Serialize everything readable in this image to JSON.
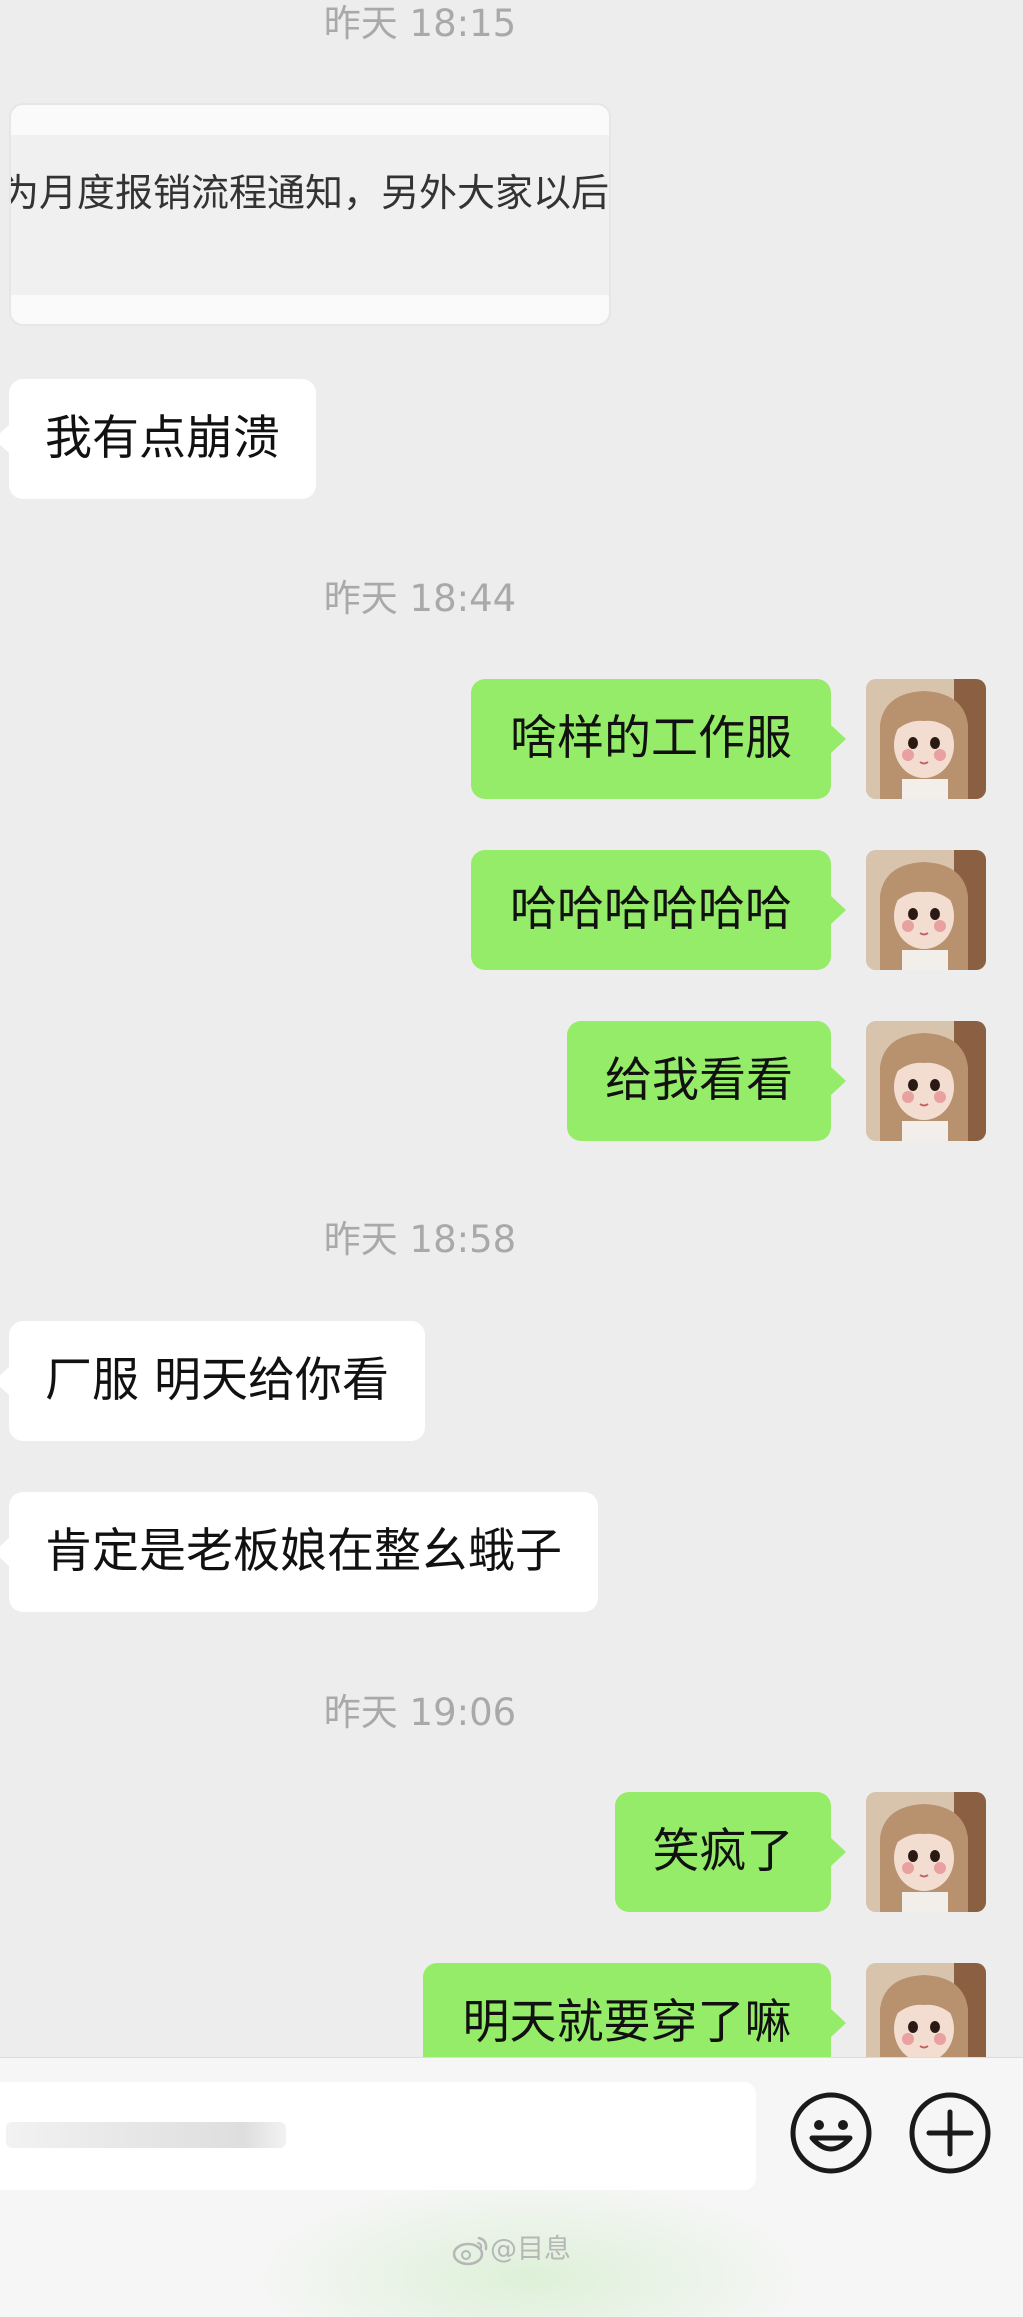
{
  "timestamps": [
    "昨天 18:15",
    "昨天 18:44",
    "昨天 18:58",
    "昨天 19:06"
  ],
  "document_preview": {
    "text": "为月度报销流程通知，另外大家以后"
  },
  "messages": [
    {
      "side": "in",
      "text": "我有点崩溃"
    },
    {
      "side": "out",
      "text": "啥样的工作服"
    },
    {
      "side": "out",
      "text": "哈哈哈哈哈哈"
    },
    {
      "side": "out",
      "text": "给我看看"
    },
    {
      "side": "in",
      "text": "厂服   明天给你看"
    },
    {
      "side": "in",
      "text": "肯定是老板娘在整幺蛾子"
    },
    {
      "side": "out",
      "text": "笑疯了"
    },
    {
      "side": "out",
      "text": "明天就要穿了嘛"
    }
  ],
  "input_bar": {
    "emoji_icon": "emoji-icon",
    "plus_icon": "plus-icon"
  },
  "watermark": {
    "icon": "weibo-icon",
    "text": "@目息"
  },
  "colors": {
    "background": "#ededed",
    "outgoing_bubble": "#95ec69",
    "incoming_bubble": "#ffffff",
    "timestamp": "#a9a9a9"
  }
}
